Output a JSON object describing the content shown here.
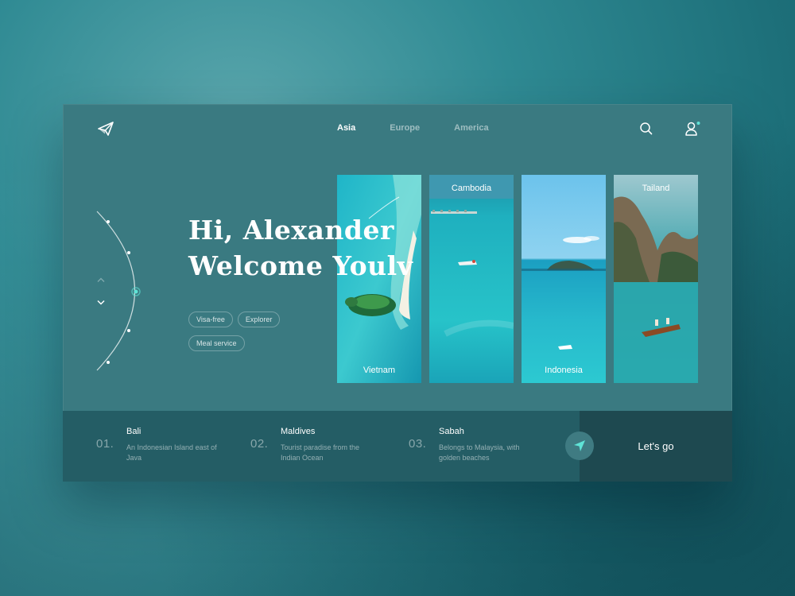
{
  "nav": {
    "items": [
      {
        "label": "Asia",
        "active": true
      },
      {
        "label": "Europe",
        "active": false
      },
      {
        "label": "America",
        "active": false
      }
    ],
    "icons": [
      "paper-plane-icon",
      "search-icon",
      "user-icon"
    ]
  },
  "hero": {
    "line1": "Hi, Alexander",
    "line2": "Welcome Youlv",
    "tags": [
      "Visa-free",
      "Explorer",
      "Meal service"
    ]
  },
  "cards": [
    {
      "label": "Vietnam"
    },
    {
      "label": "Cambodia"
    },
    {
      "label": "Indonesia"
    },
    {
      "label": "Tailand"
    }
  ],
  "destinations": [
    {
      "num": "01.",
      "name": "Bali",
      "desc": "An Indonesian Island east of Java"
    },
    {
      "num": "02.",
      "name": "Maldives",
      "desc": "Tourist paradise from the Indian Ocean"
    },
    {
      "num": "03.",
      "name": "Sabah",
      "desc": "Belongs to Malaysia, with golden beaches"
    }
  ],
  "cta": {
    "label": "Let's go"
  },
  "colors": {
    "accent": "#5fe3d6",
    "panel": "#3a7a81",
    "bottom": "#245d65",
    "cta": "#1e4950"
  }
}
